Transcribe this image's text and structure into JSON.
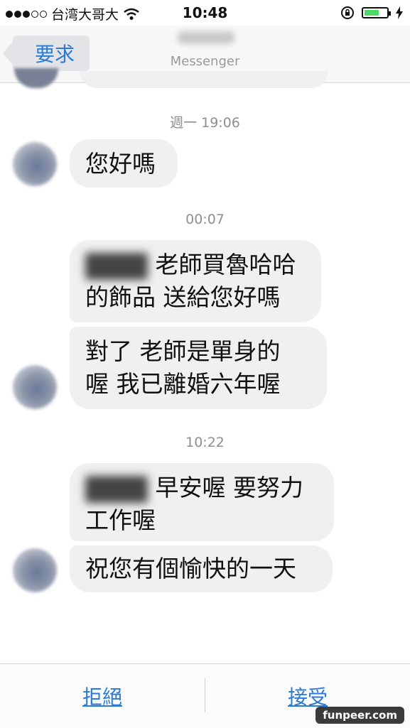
{
  "status_bar": {
    "carrier": "台湾大哥大",
    "time": "10:48"
  },
  "nav": {
    "back_label": "要求",
    "subtitle": "Messenger"
  },
  "messages": {
    "ts1": "週一 19:06",
    "m1": "您好嗎",
    "ts2": "00:07",
    "m2_line1": "老師買魯哈哈",
    "m2_line2": "的飾品 送給您好嗎",
    "m3_line1": "對了  老師是單身的",
    "m3_line2": "喔   我已離婚六年喔",
    "ts3": "10:22",
    "m4_line1": "早安喔  要努力",
    "m4_line2": "工作喔",
    "m5": "祝您有個愉快的一天"
  },
  "actions": {
    "decline": "拒絕",
    "accept": "接受"
  },
  "watermark": "funpeer.com",
  "colors": {
    "accent": "#2b7bd6",
    "bubble": "#f0f0f1",
    "battery": "#4cd964"
  }
}
